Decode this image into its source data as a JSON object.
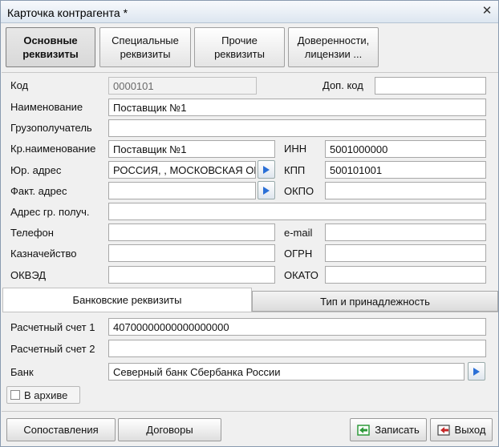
{
  "window": {
    "title": "Карточка контрагента *",
    "close_glyph": "✕"
  },
  "tabs": [
    {
      "label": "Основные\nреквизиты",
      "active": true
    },
    {
      "label": "Специальные\nреквизиты",
      "active": false
    },
    {
      "label": "Прочие\nреквизиты",
      "active": false
    },
    {
      "label": "Доверенности,\nлицензии ...",
      "active": false
    }
  ],
  "form": {
    "code": {
      "label": "Код",
      "value": "0000101"
    },
    "extra_code": {
      "label": "Доп. код",
      "value": ""
    },
    "name": {
      "label": "Наименование",
      "value": "Поставщик №1"
    },
    "consignee": {
      "label": "Грузополучатель",
      "value": ""
    },
    "short_name": {
      "label": "Кр.наименование",
      "value": "Поставщик №1"
    },
    "inn": {
      "label": "ИНН",
      "value": "5001000000"
    },
    "legal_address": {
      "label": "Юр. адрес",
      "value": "РОССИЯ, , МОСКОВСКАЯ ОБЛ"
    },
    "kpp": {
      "label": "КПП",
      "value": "500101001"
    },
    "actual_address": {
      "label": "Факт. адрес",
      "value": ""
    },
    "okpo": {
      "label": "ОКПО",
      "value": ""
    },
    "consignee_address": {
      "label": "Адрес гр. получ.",
      "value": ""
    },
    "phone": {
      "label": "Телефон",
      "value": ""
    },
    "email": {
      "label": "e-mail",
      "value": ""
    },
    "treasury": {
      "label": "Казначейство",
      "value": ""
    },
    "ogrn": {
      "label": "ОГРН",
      "value": ""
    },
    "okved": {
      "label": "ОКВЭД",
      "value": ""
    },
    "okato": {
      "label": "ОКАТО",
      "value": ""
    }
  },
  "subtabs": [
    {
      "label": "Банковские реквизиты",
      "active": true
    },
    {
      "label": "Тип и принадлежность",
      "active": false
    }
  ],
  "bank": {
    "account1": {
      "label": "Расчетный счет 1",
      "value": "40700000000000000000"
    },
    "account2": {
      "label": "Расчетный счет 2",
      "value": ""
    },
    "bank": {
      "label": "Банк",
      "value": "Северный банк Сбербанка России"
    }
  },
  "archive": {
    "label": "В архиве",
    "checked": false
  },
  "buttons": {
    "mappings": "Сопоставления",
    "contracts": "Договоры",
    "save": "Записать",
    "exit": "Выход"
  },
  "colors": {
    "accent_blue": "#2a6fd6",
    "save_green": "#2e9a3a",
    "exit_red": "#c62828"
  }
}
